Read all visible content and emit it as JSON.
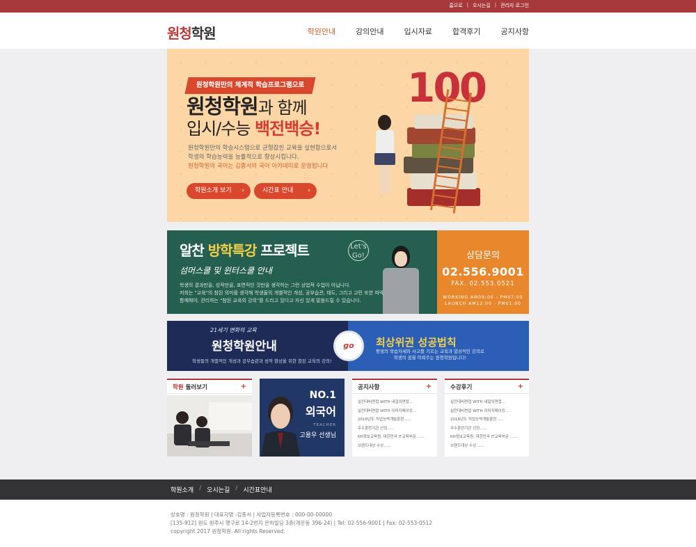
{
  "top_links": [
    "홈으로",
    "오시는길",
    "관리자 로그인"
  ],
  "logo": {
    "accent": "원청",
    "rest": "학원"
  },
  "nav": [
    "학원안내",
    "강의안내",
    "입시자료",
    "합격후기",
    "공지사항"
  ],
  "hero": {
    "ribbon": "원청학원만의 체계적 학습프로그램으로",
    "headline_bold": "원청학원",
    "headline_light": "과 함께",
    "line2_a": "입시/수능",
    "line2_b": "백전백승!",
    "desc1": "원청학원만의 학습시스템으로 균형잡힌 교육을 실현함으로서",
    "desc2": "학생의 학습능력을 능률적으로 향상시킵니다.",
    "desc3": "원청학원의 국어는 김종서의 국어 아카데미로 운영됩니다",
    "btn1": "학원소개 보기",
    "btn2": "시간표 안내",
    "number": "100"
  },
  "banner2": {
    "title_a": "알찬",
    "title_b": "방학특강",
    "title_c": "프로젝트",
    "subtitle": "섬머스쿨 및 윈터스쿨 안내",
    "lets_go": "Let's Go!",
    "text1": "학생의 결과만을, 성적만을, 표면적인 것만을 생각하는 그런 상업적 수업이 아닙니다.",
    "text2": "저희는 \"교육\"의 참된 의미를 생각해 학생들의 개별적인 개성, 공부습관, 태도, 그리고 고민 또한 파악해,",
    "text3": "함께해야, 관리하는 \"참된 교육의 강의\"를 드리고 있다고 자신 있게 말씀드릴 수 있습니다.",
    "consult_title": "상담문의",
    "consult_phone": "02.556.9001",
    "consult_fax": "FAX. 02.553.0521",
    "hours1": "WORKING  AM09:00 - PM07:00",
    "hours2": "LAUNCH  AM12:00 - PM01:00"
  },
  "banner3": {
    "small": "21세기 변화의 교육",
    "title": "원청학원안내",
    "desc": "학생들의 개별적인 개성과 공부습관과 성적 향상을 위한 참된 교육의 강의!",
    "go": "go",
    "right_title": "최상위권 성공법칙",
    "right_desc1": "평생의 학습자세와 사고를 기르는 교육과 열성적인 강의로",
    "right_desc2": "학생의 꿈을 이뤄주는 원청학원입니다!"
  },
  "boxes": {
    "tour_title_a": "학원",
    "tour_title_b": "둘러보기",
    "teacher_no": "NO.1",
    "teacher_subject": "외국어",
    "teacher_label": "TEACHER",
    "teacher_name": "고용우 선생님",
    "notice_title": "공지사항",
    "notice_items": [
      "실전대비면접 WITH 내일의면접...",
      "실전대비면접 WITH 이미지메이킹...",
      "2016년도 직업능력개발훈련......",
      "우수훈련기관 선정......",
      "KH정보교육원, 대한민국 IT교육부문 ......",
      "브랜드대상 수상......"
    ],
    "review_title": "수강후기",
    "review_items": [
      "실전대비면접 WITH 내일의면접...",
      "실전대비면접 WITH 이미지메이킹...",
      "2016년도 직업능력개발훈련......",
      "우수훈련기관 선정......",
      "KH정보교육원, 대한민국 IT교육부문 ......",
      "브랜드대상 수상......"
    ],
    "plus": "+"
  },
  "footer_nav": [
    "학원소개",
    "오시는길",
    "시간표안내"
  ],
  "footer": {
    "line1": "상호명 : 원청학원 | 대표자명 :김종서 | 사업자등록번호 : 000-00-00000",
    "line2": "[135-912] 원도 원주시 행구로 14-2번지 은하빌딩 3층(개운동 396-24) | Tel: 02-556-9001 | Fax: 02-553-0512",
    "line3": "copyright 2017 원청학원. All rights Reserved."
  }
}
